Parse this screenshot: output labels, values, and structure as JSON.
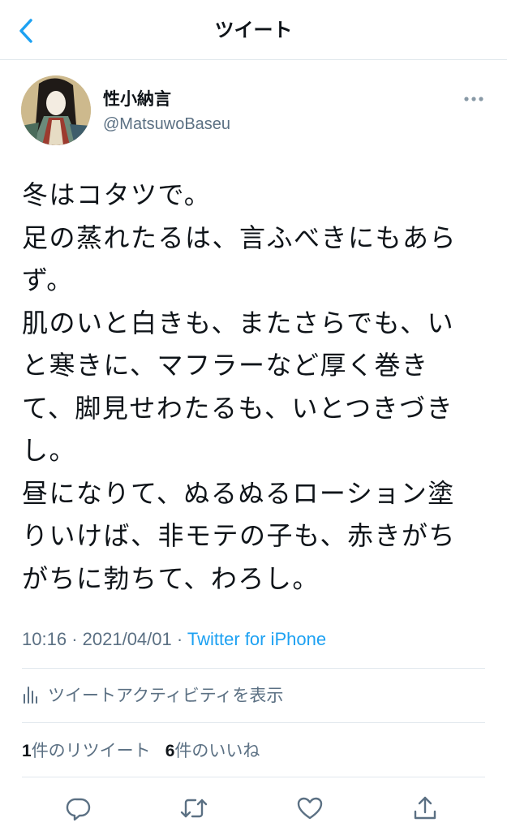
{
  "header": {
    "title": "ツイート",
    "back_icon": "chevron-left-icon"
  },
  "author": {
    "name": "性小納言",
    "handle": "@MatsuwoBaseu"
  },
  "tweet": {
    "lines": [
      "冬はコタツで。",
      "足の蒸れたるは、言ふべきにもあら",
      "ず。",
      "肌のいと白きも、またさらでも、い",
      "と寒きに、マフラーなど厚く巻き",
      "て、脚見せわたるも、いとつきづき",
      "し。",
      "昼になりて、ぬるぬるローション塗",
      "りいけば、非モテの子も、赤きがち",
      "がちに勃ちて、わろし。"
    ]
  },
  "meta": {
    "time": "10:16",
    "separator1": "·",
    "date": "2021/04/01",
    "separator2": "·",
    "source": "Twitter for iPhone"
  },
  "activity": {
    "label": "ツイートアクティビティを表示"
  },
  "stats": {
    "retweets_count": "1",
    "retweets_label": "件のリツイート",
    "likes_count": "6",
    "likes_label": "件のいいね"
  },
  "actions": {
    "reply_icon": "reply-icon",
    "retweet_icon": "retweet-icon",
    "like_icon": "heart-icon",
    "share_icon": "share-icon"
  },
  "colors": {
    "accent": "#1da1f2",
    "text": "#0f1419",
    "secondary": "#5b7083",
    "divider": "#e1e8ed"
  }
}
